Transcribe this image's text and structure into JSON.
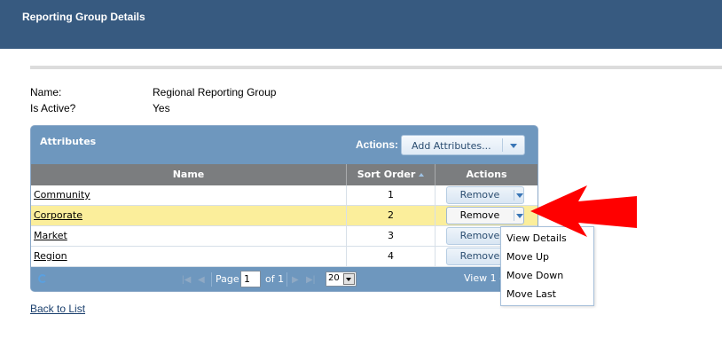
{
  "header": {
    "title": "Reporting Group Details"
  },
  "details": [
    {
      "label": "Name:",
      "value": "Regional Reporting Group"
    },
    {
      "label": "Is Active?",
      "value": "Yes"
    }
  ],
  "grid": {
    "caption": "Attributes",
    "actions_label": "Actions:",
    "add_button": "Add Attributes...",
    "columns": [
      "Name",
      "Sort Order",
      "Actions"
    ],
    "rows": [
      {
        "name": "Community",
        "sort": "1",
        "action": "Remove"
      },
      {
        "name": "Corporate",
        "sort": "2",
        "action": "Remove"
      },
      {
        "name": "Market",
        "sort": "3",
        "action": "Remove"
      },
      {
        "name": "Region",
        "sort": "4",
        "action": "Remove"
      }
    ],
    "pager": {
      "page_label": "Page",
      "page_value": "1",
      "of_label": "of 1",
      "rows_per_page": "20",
      "view_text": "View 1 -"
    }
  },
  "menu": {
    "items": [
      "View Details",
      "Move Up",
      "Move Down",
      "Move Last"
    ]
  },
  "back_link": "Back to List",
  "colors": {
    "header_bg": "#375a80",
    "grid_bg": "#6e97be",
    "highlight_row": "#fbee9b",
    "arrow": "#ff0000"
  },
  "icons": [
    "refresh-icon",
    "chevron-down-icon",
    "sort-asc-icon",
    "red-arrow-icon"
  ]
}
